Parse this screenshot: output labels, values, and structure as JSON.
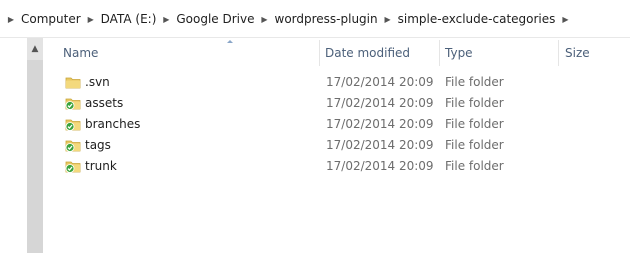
{
  "breadcrumb": {
    "items": [
      "Computer",
      "DATA (E:)",
      "Google Drive",
      "wordpress-plugin",
      "simple-exclude-categories"
    ]
  },
  "columns": {
    "name": "Name",
    "date_modified": "Date modified",
    "type": "Type",
    "size": "Size"
  },
  "files": [
    {
      "name": ".svn",
      "date": "17/02/2014 20:09",
      "type": "File folder",
      "icon": "plain-folder-icon"
    },
    {
      "name": "assets",
      "date": "17/02/2014 20:09",
      "type": "File folder",
      "icon": "synced-folder-icon"
    },
    {
      "name": "branches",
      "date": "17/02/2014 20:09",
      "type": "File folder",
      "icon": "synced-folder-icon"
    },
    {
      "name": "tags",
      "date": "17/02/2014 20:09",
      "type": "File folder",
      "icon": "synced-folder-icon"
    },
    {
      "name": "trunk",
      "date": "17/02/2014 20:09",
      "type": "File folder",
      "icon": "synced-folder-icon"
    }
  ],
  "colors": {
    "folder": "#e8c862",
    "sync_badge": "#3aa33a",
    "header_text": "#4c607a"
  }
}
